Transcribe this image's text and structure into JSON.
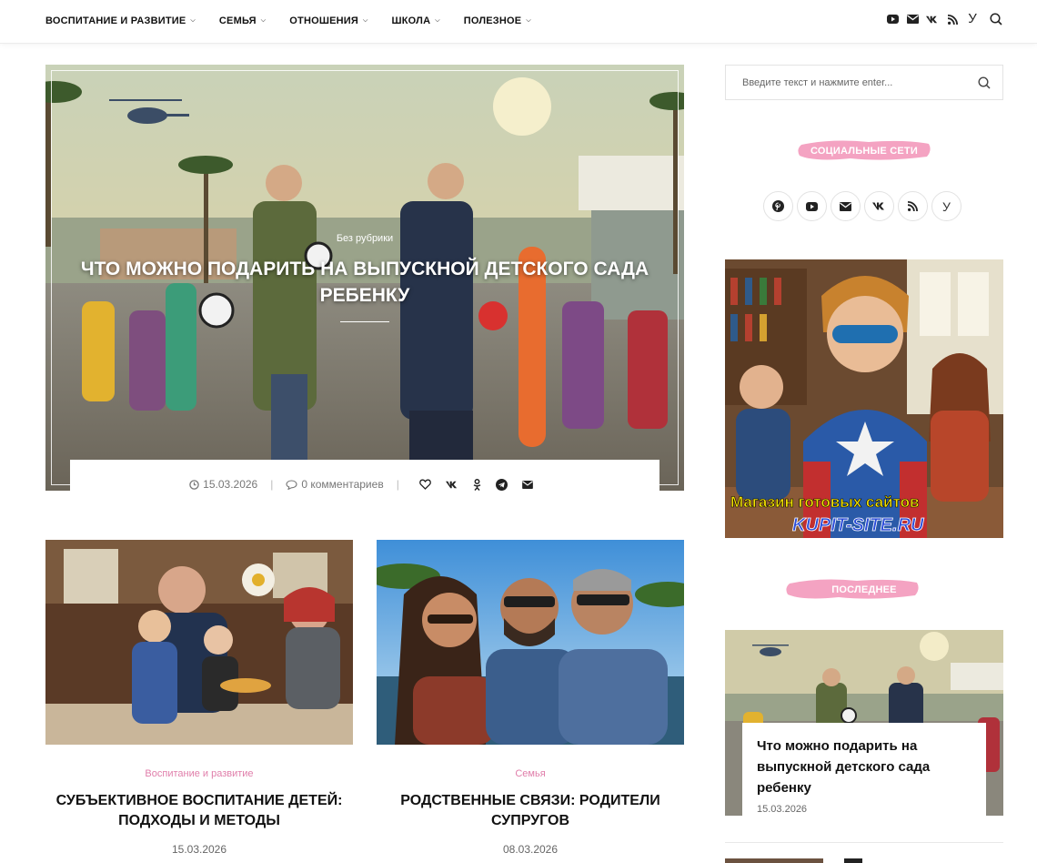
{
  "nav": {
    "items": [
      {
        "label": "ВОСПИТАНИЕ И РАЗВИТИЕ"
      },
      {
        "label": "СЕМЬЯ"
      },
      {
        "label": "ОТНОШЕНИЯ"
      },
      {
        "label": "ШКОЛА"
      },
      {
        "label": "ПОЛЕЗНОЕ"
      }
    ],
    "icons": [
      "youtube-icon",
      "email-icon",
      "vk-icon",
      "rss-icon",
      "yandex-icon",
      "search-icon"
    ],
    "yandex_letter": "У"
  },
  "featured": {
    "category": "Без рубрики",
    "title": "ЧТО МОЖНО ПОДАРИТЬ НА ВЫПУСКНОЙ ДЕТСКОГО САДА РЕБЕНКУ",
    "date": "15.03.2026",
    "comments": "0 комментариев",
    "share_icons": [
      "heart-icon",
      "vk-icon",
      "odnoklassniki-icon",
      "telegram-icon",
      "email-icon"
    ]
  },
  "posts": [
    {
      "category": "Воспитание и развитие",
      "title": "СУБЪЕКТИВНОЕ ВОСПИТАНИЕ ДЕТЕЙ: ПОДХОДЫ И МЕТОДЫ",
      "date": "15.03.2026"
    },
    {
      "category": "Семья",
      "title": "РОДСТВЕННЫЕ СВЯЗИ: РОДИТЕЛИ СУПРУГОВ",
      "date": "08.03.2026"
    }
  ],
  "sidebar": {
    "search_placeholder": "Введите текст и нажмите enter...",
    "social_heading": "СОЦИАЛЬНЫЕ СЕТИ",
    "social_icons": [
      "pinterest-icon",
      "youtube-icon",
      "email-icon",
      "vk-icon",
      "rss-icon",
      "yandex-icon"
    ],
    "yandex_letter": "У",
    "ad": {
      "line1": "Магазин готовых сайтов",
      "line2": "KUPIT-SITE.RU"
    },
    "latest_heading": "ПОСЛЕДНЕЕ",
    "latest": {
      "title": "Что можно подарить на выпускной детского сада ребенку",
      "date": "15.03.2026"
    }
  },
  "colors": {
    "accent_pink": "#e07eaa",
    "brush_pink": "#f4a3c2",
    "text": "#111111",
    "muted": "#777777"
  }
}
